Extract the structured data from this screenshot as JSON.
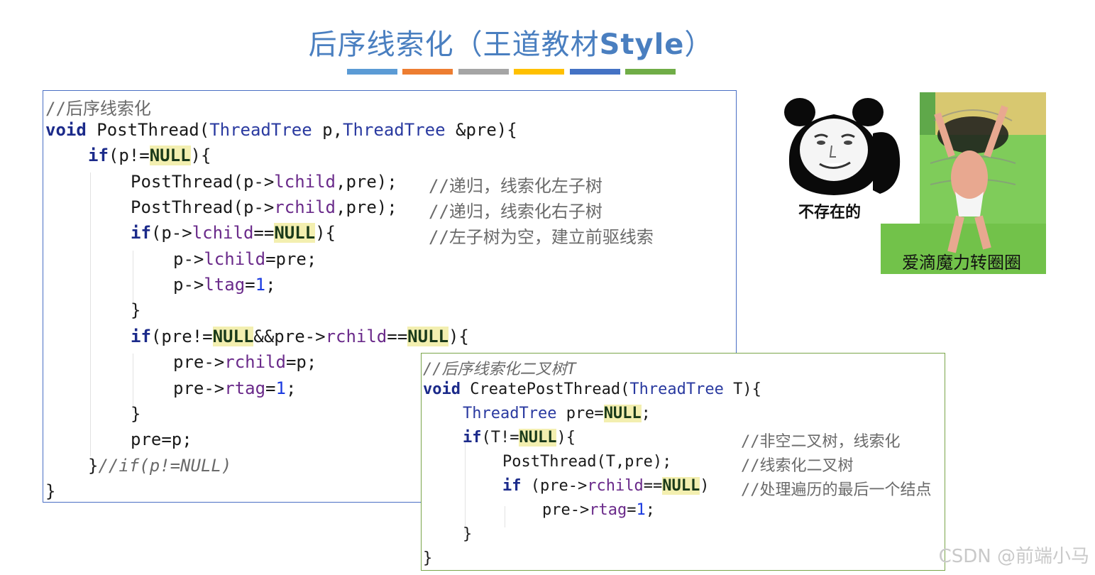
{
  "title": {
    "part1": "后序线索化（王道教材",
    "part2": "Style",
    "part3": "）"
  },
  "colors": {
    "title": "#4a7fc0",
    "bar1": "#5b9bd5",
    "bar2": "#ed7d31",
    "bar3": "#a5a5a5",
    "bar4": "#ffc000",
    "bar5": "#4472c4",
    "bar6": "#70ad47"
  },
  "code1": {
    "l1": "//后序线索化",
    "l2_kw": "void",
    "l2_fn": " PostThread(",
    "l2_t1": "ThreadTree",
    "l2_m": " p,",
    "l2_t2": "ThreadTree",
    "l2_e": " &pre){",
    "l3_kw": "if",
    "l3_a": "(p!=",
    "l3_null": "NULL",
    "l3_b": "){",
    "l4_a": "PostThread(p->",
    "l4_f": "lchild",
    "l4_b": ",pre);",
    "l4_c": "//递归，线索化左子树",
    "l5_a": "PostThread(p->",
    "l5_f": "rchild",
    "l5_b": ",pre);",
    "l5_c": "//递归，线索化右子树",
    "l6_kw": "if",
    "l6_a": "(p->",
    "l6_f": "lchild",
    "l6_b": "==",
    "l6_null": "NULL",
    "l6_c": "){",
    "l6_cmt": "//左子树为空，建立前驱线索",
    "l7_a": "p->",
    "l7_f": "lchild",
    "l7_b": "=pre;",
    "l8_a": "p->",
    "l8_f": "ltag",
    "l8_b": "=",
    "l8_n": "1",
    "l8_c": ";",
    "l9": "}",
    "l10_kw": "if",
    "l10_a": "(pre!=",
    "l10_null1": "NULL",
    "l10_b": "&&pre->",
    "l10_f": "rchild",
    "l10_c": "==",
    "l10_null2": "NULL",
    "l10_d": "){",
    "l11_a": "pre->",
    "l11_f": "rchild",
    "l11_b": "=p;",
    "l12_a": "pre->",
    "l12_f": "rtag",
    "l12_b": "=",
    "l12_n": "1",
    "l12_c": ";",
    "l13": "}",
    "l14": "pre=p;",
    "l15_a": "}",
    "l15_c": "//if(p!=NULL)",
    "l16": "}"
  },
  "code2": {
    "l1": "//后序线索化二叉树T",
    "l2_kw": "void",
    "l2_fn": " CreatePostThread(",
    "l2_t": "ThreadTree",
    "l2_e": " T){",
    "l3_t": "ThreadTree",
    "l3_a": " pre=",
    "l3_null": "NULL",
    "l3_b": ";",
    "l4_kw": "if",
    "l4_a": "(T!=",
    "l4_null": "NULL",
    "l4_b": "){",
    "l4_c": "//非空二叉树，线索化",
    "l5_a": "PostThread(T,pre);",
    "l5_c": "//线索化二叉树",
    "l6_kw": "if",
    "l6_a": " (pre->",
    "l6_f": "rchild",
    "l6_b": "==",
    "l6_null": "NULL",
    "l6_c": ")",
    "l6_cmt": "//处理遍历的最后一个结点",
    "l7_a": "pre->",
    "l7_f": "rtag",
    "l7_b": "=",
    "l7_n": "1",
    "l7_c": ";",
    "l8": "}",
    "l9": "}"
  },
  "stickers": {
    "panda_caption": "不存在的",
    "spin_caption": "爱滴魔力转圈圈"
  },
  "watermark": "CSDN @前端小马"
}
